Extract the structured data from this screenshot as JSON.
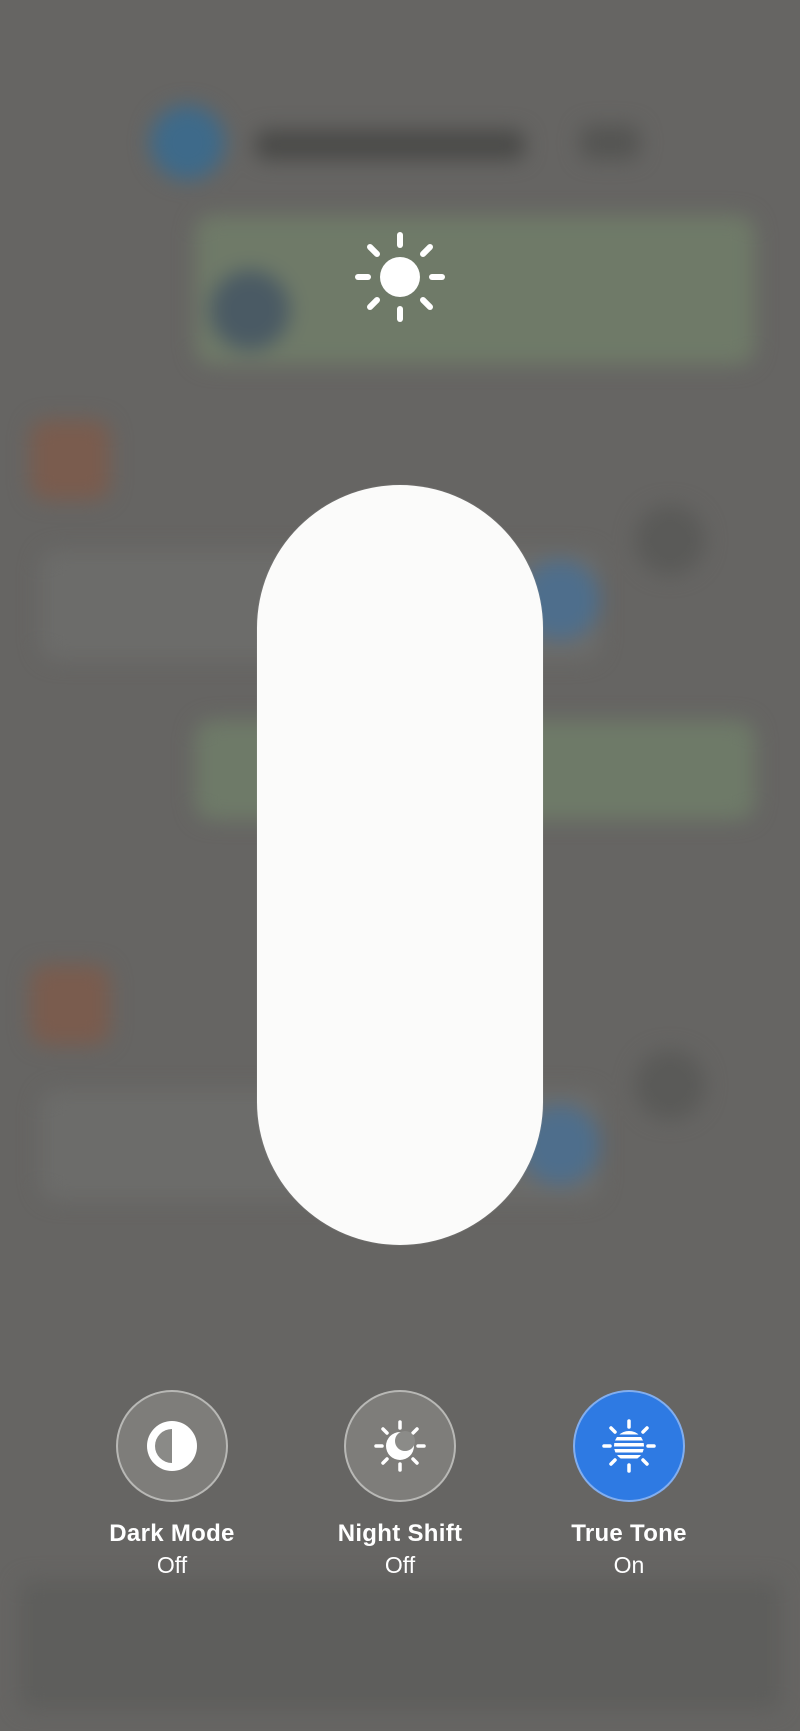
{
  "brightness": {
    "level": 1.0
  },
  "toggles": [
    {
      "label": "Dark Mode",
      "state": "Off",
      "icon": "dark-mode-icon",
      "active": false
    },
    {
      "label": "Night Shift",
      "state": "Off",
      "icon": "night-shift-icon",
      "active": false
    },
    {
      "label": "True Tone",
      "state": "On",
      "icon": "true-tone-icon",
      "active": true
    }
  ],
  "colors": {
    "accent": "#2e7ae3",
    "fill": "#fbfbfa",
    "overlay": "#666563"
  }
}
